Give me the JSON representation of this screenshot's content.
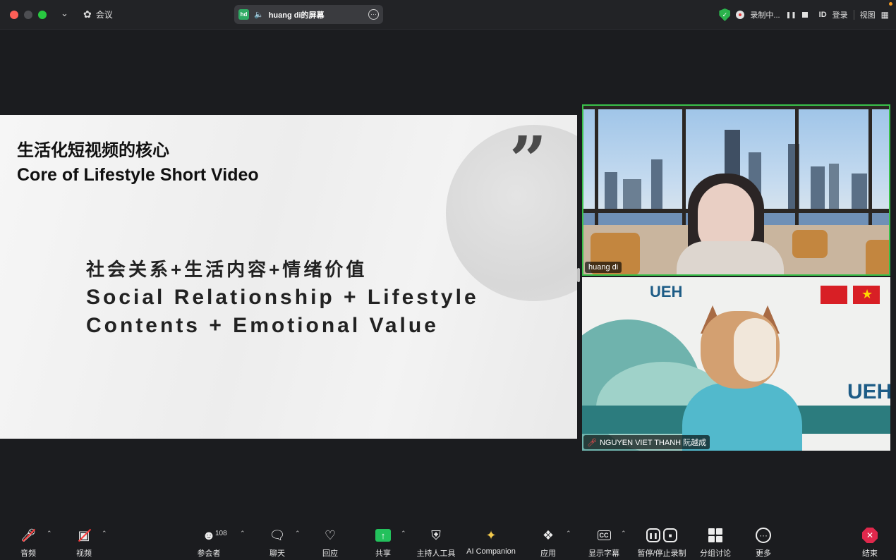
{
  "titlebar": {
    "meeting_label": "会议",
    "share_title": "huang di的屏幕",
    "share_badge": "hd",
    "recording_label": "录制中...",
    "id_label": "ID",
    "login_label": "登录",
    "view_label": "视图"
  },
  "slide": {
    "title_cn": "生活化短视频的核心",
    "title_en": "Core of Lifestyle Short Video",
    "body_cn": "社会关系+生活内容+情绪价值",
    "body_en": "Social Relationship + Lifestyle Contents + Emotional Value",
    "quote": "„"
  },
  "participants": [
    {
      "name": "huang di"
    },
    {
      "name": "NGUYEN VIET THANH 阮越成"
    }
  ],
  "tile2_logos": {
    "ueh": "UEH"
  },
  "toolbar": {
    "audio": "音频",
    "video": "视频",
    "participants": "参会者",
    "participants_count": "108",
    "chat": "聊天",
    "reactions": "回应",
    "share": "共享",
    "host_tools": "主持人工具",
    "ai_companion": "AI Companion",
    "apps": "应用",
    "captions": "显示字幕",
    "captions_badge": "CC",
    "record": "暂停/停止录制",
    "breakout": "分组讨论",
    "more": "更多",
    "end": "结束"
  },
  "colors": {
    "accent_green": "#23c15c",
    "end_red": "#e0284c",
    "speaker_border": "#39c14a"
  }
}
